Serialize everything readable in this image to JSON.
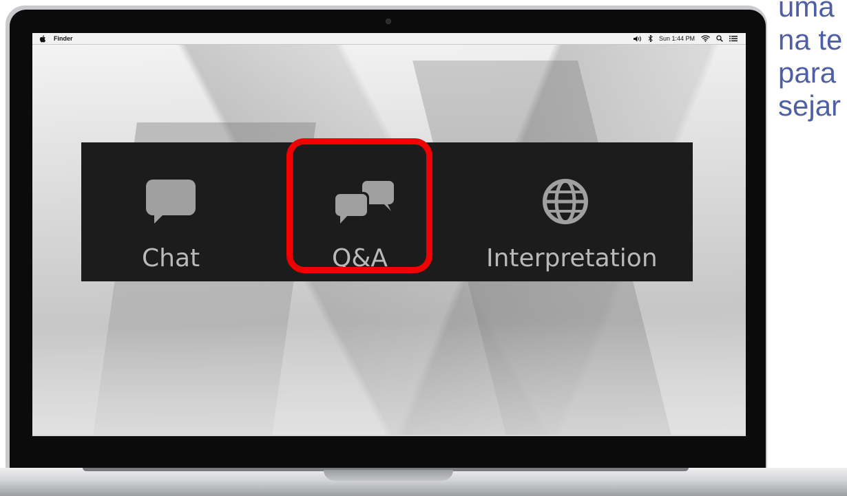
{
  "menubar": {
    "app_name": "Finder",
    "clock": "Sun 1:44 PM"
  },
  "toolbar": {
    "items": [
      {
        "label": "Chat",
        "icon": "chat-bubble-icon"
      },
      {
        "label": "Q&A",
        "icon": "qa-bubbles-icon"
      },
      {
        "label": "Interpretation",
        "icon": "globe-icon"
      }
    ],
    "highlighted_item": "Q&A",
    "highlight_color": "#f00000"
  },
  "side_text": {
    "lines": [
      "uma",
      "na te",
      "para",
      "sejar"
    ]
  }
}
